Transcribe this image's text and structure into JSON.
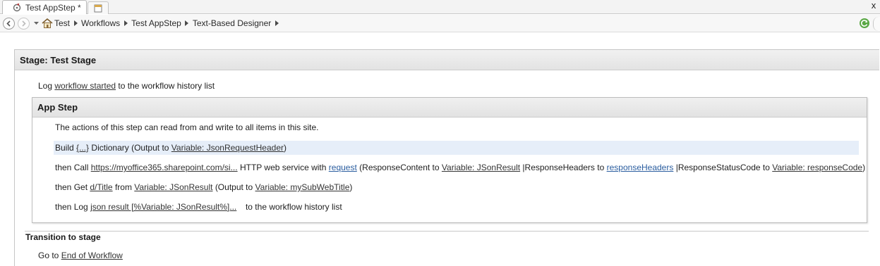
{
  "tabs": {
    "active_label": "Test AppStep *",
    "icons": {
      "workflow": "workflow-icon",
      "new_tab": "new-tab-icon",
      "close": "close-icon"
    },
    "close_glyph": "x"
  },
  "navigation": {
    "back_icon": "back-arrow-icon",
    "forward_icon": "forward-arrow-icon",
    "history_icon": "chevron-down-icon",
    "home_icon": "home-icon",
    "refresh_icon": "refresh-icon",
    "breadcrumbs": [
      "Test",
      "Workflows",
      "Test AppStep",
      "Text-Based Designer"
    ]
  },
  "stage": {
    "title": "Stage: Test Stage",
    "log_line": {
      "prefix": "Log",
      "link": "workflow started",
      "suffix": "to the workflow history list"
    },
    "app_step": {
      "title": "App Step",
      "description": "The actions of this step can read from and write to all items in this site.",
      "actions": {
        "build": {
          "prefix": "Build",
          "dict": "{...}",
          "middle": "Dictionary (Output to",
          "var": "Variable: JsonRequestHeader",
          "end": ")"
        },
        "call": {
          "prefix": "then Call",
          "url": "https://myoffice365.sharepoint.com/si...",
          "middle": "HTTP web service with",
          "request": "request",
          "resp_content_label": "(ResponseContent to",
          "resp_content_var": "Variable: JSonResult",
          "resp_headers_label": "|ResponseHeaders to",
          "resp_headers_var": "responseHeaders",
          "resp_status_label": "|ResponseStatusCode to",
          "resp_status_var": "Variable: responseCode",
          "end": ")"
        },
        "get": {
          "prefix": "then Get",
          "path": "d/Title",
          "from": "from",
          "source": "Variable: JSonResult",
          "output_label": "(Output to",
          "output_var": "Variable: mySubWebTitle",
          "end": ")"
        },
        "log": {
          "prefix": "then Log",
          "link": "json result [%Variable: JSonResult%]...",
          "suffix": "to the workflow history list"
        }
      }
    },
    "transition": {
      "title": "Transition to stage",
      "prefix": "Go to",
      "link": "End of Workflow"
    }
  },
  "colors": {
    "highlight_row": "#e6eef9",
    "link_blue": "#2a5d9f",
    "header_gray": "#e3e3e3"
  }
}
